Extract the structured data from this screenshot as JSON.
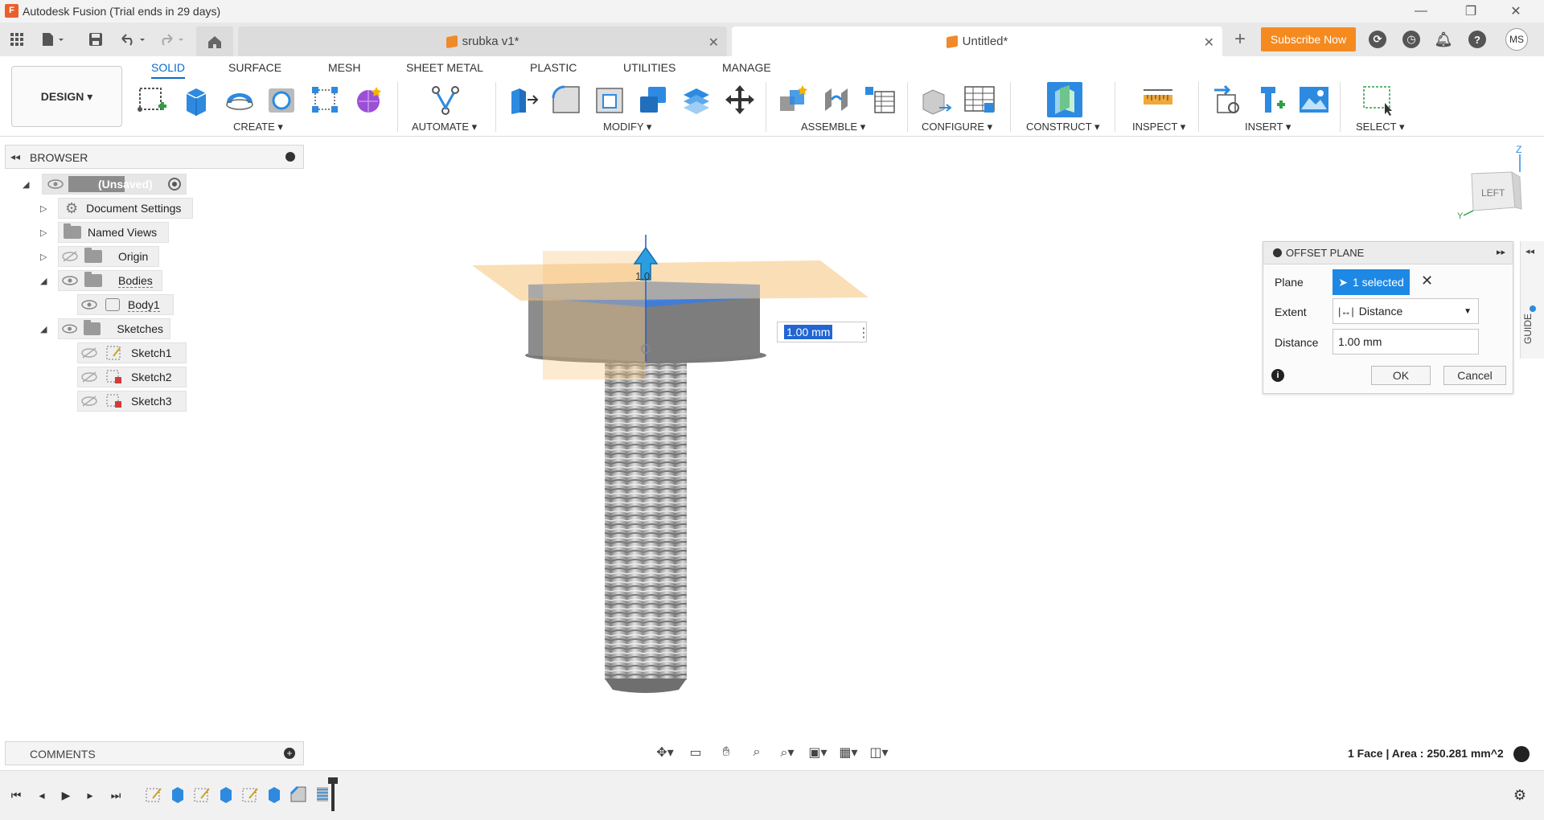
{
  "window": {
    "title": "Autodesk Fusion (Trial ends in 29 days)",
    "minimize": "—",
    "restore": "❐",
    "close": "✕"
  },
  "tabs": [
    {
      "label": "srubka v1*",
      "active": false
    },
    {
      "label": "Untitled*",
      "active": true
    }
  ],
  "header_right": {
    "subscribe": "Subscribe Now",
    "avatar": "MS"
  },
  "workspace": {
    "design_label": "DESIGN ▾"
  },
  "ribbon_tabs": [
    "SOLID",
    "SURFACE",
    "MESH",
    "SHEET METAL",
    "PLASTIC",
    "UTILITIES",
    "MANAGE"
  ],
  "ribbon_groups": {
    "create": "CREATE ▾",
    "automate": "AUTOMATE ▾",
    "modify": "MODIFY ▾",
    "assemble": "ASSEMBLE ▾",
    "configure": "CONFIGURE ▾",
    "construct": "CONSTRUCT ▾",
    "inspect": "INSPECT ▾",
    "insert": "INSERT ▾",
    "select": "SELECT ▾"
  },
  "browser": {
    "title": "BROWSER",
    "root": "(Unsaved)",
    "items": {
      "document_settings": "Document Settings",
      "named_views": "Named Views",
      "origin": "Origin",
      "bodies": "Bodies",
      "body1": "Body1",
      "sketches": "Sketches",
      "sketch1": "Sketch1",
      "sketch2": "Sketch2",
      "sketch3": "Sketch3"
    }
  },
  "viewport": {
    "inline_value": "1.00 mm",
    "arrow_label": "1.0",
    "viewcube_face": "LEFT",
    "axis_z": "Z",
    "axis_y": "Y",
    "guide": "GUIDE"
  },
  "dialog": {
    "title": "OFFSET PLANE",
    "plane_label": "Plane",
    "plane_value": "1 selected",
    "extent_label": "Extent",
    "extent_value": "Distance",
    "distance_label": "Distance",
    "distance_value": "1.00 mm",
    "ok": "OK",
    "cancel": "Cancel"
  },
  "comments": {
    "title": "COMMENTS"
  },
  "status": {
    "text": "1 Face | Area : 250.281 mm^2"
  },
  "colors": {
    "accent": "#0b6bc8",
    "subscribe": "#f58a1f",
    "selection": "#1e88e5",
    "plane": "#f6c27a"
  }
}
